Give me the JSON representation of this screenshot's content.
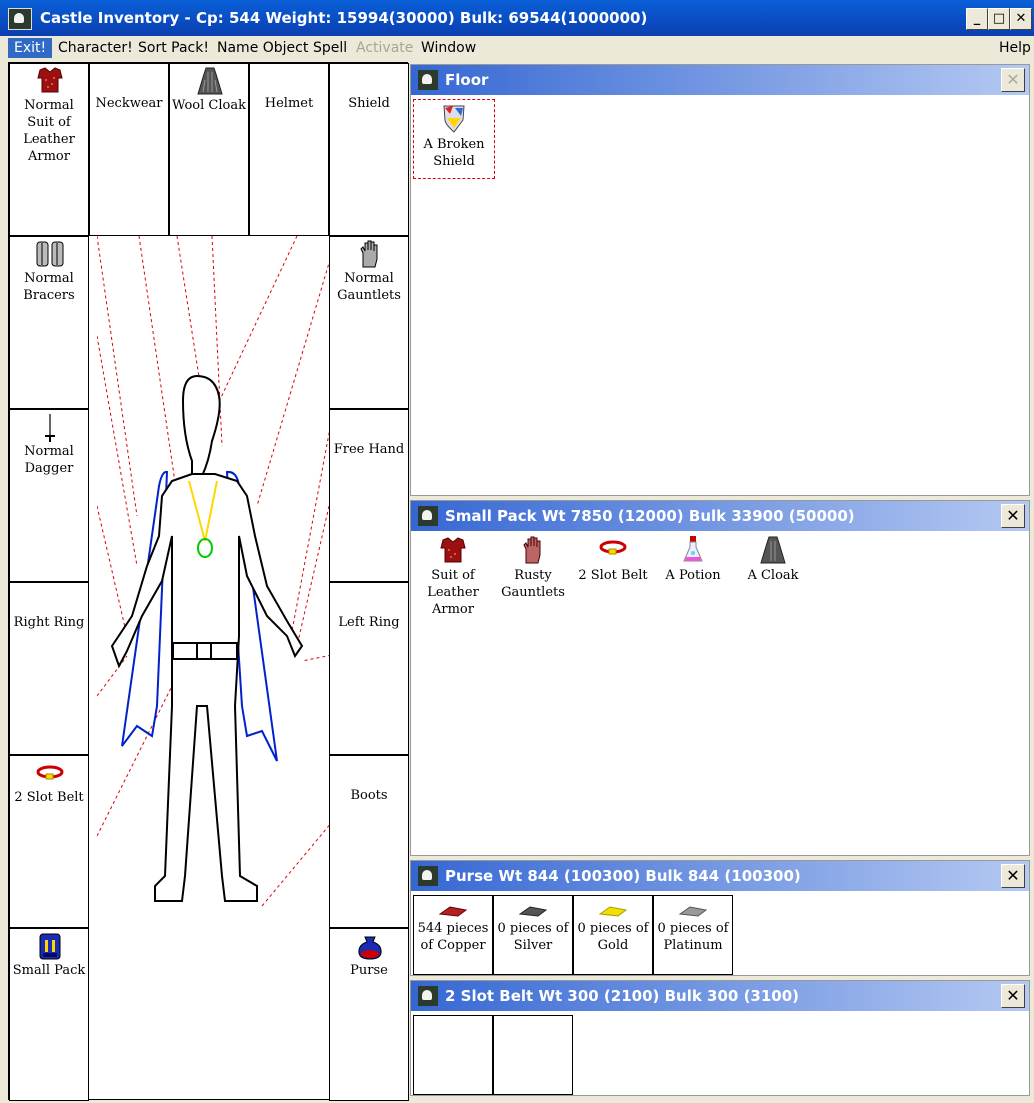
{
  "window": {
    "title": "Castle Inventory - Cp: 544 Weight: 15994(30000) Bulk: 69544(1000000)",
    "min": "_",
    "max": "□",
    "close": "✕"
  },
  "menu": {
    "exit": "Exit!",
    "character": "Character!",
    "sort_pack": "Sort Pack!",
    "name_object": "Name Object",
    "spell": "Spell",
    "activate": "Activate",
    "window": "Window",
    "help": "Help"
  },
  "equipment": {
    "armor": "Normal Suit of Leather Armor",
    "neckwear": "Neckwear",
    "cloak": "Wool Cloak",
    "helmet": "Helmet",
    "shield": "Shield",
    "bracers": "Normal Bracers",
    "gauntlets": "Normal Gauntlets",
    "weapon": "Normal Dagger",
    "free_hand": "Free Hand",
    "right_ring": "Right Ring",
    "left_ring": "Left Ring",
    "belt": "2 Slot Belt",
    "boots": "Boots",
    "pack": "Small Pack",
    "purse": "Purse"
  },
  "floor": {
    "title": "Floor",
    "close": "✕",
    "items": [
      {
        "label": "A Broken Shield",
        "icon": "shield-icon"
      }
    ]
  },
  "pack": {
    "title": "Small Pack Wt 7850 (12000) Bulk 33900 (50000)",
    "close": "✕",
    "items": [
      {
        "label": "Suit of Leather Armor",
        "icon": "armor-icon"
      },
      {
        "label": "Rusty Gauntlets",
        "icon": "gauntlets-icon"
      },
      {
        "label": "2 Slot Belt",
        "icon": "belt-icon"
      },
      {
        "label": "A Potion",
        "icon": "potion-icon"
      },
      {
        "label": "A Cloak",
        "icon": "cloak-icon"
      }
    ]
  },
  "purse": {
    "title": "Purse Wt 844 (100300) Bulk 844 (100300)",
    "close": "✕",
    "items": [
      {
        "label": "544 pieces of Copper",
        "color": "#b22222"
      },
      {
        "label": "0 pieces of Silver",
        "color": "#555555"
      },
      {
        "label": "0 pieces of Gold",
        "color": "#f0e000"
      },
      {
        "label": "0 pieces of Platinum",
        "color": "#999999"
      }
    ]
  },
  "belt": {
    "title": "2 Slot Belt Wt 300 (2100) Bulk 300 (3100)",
    "close": "✕"
  }
}
